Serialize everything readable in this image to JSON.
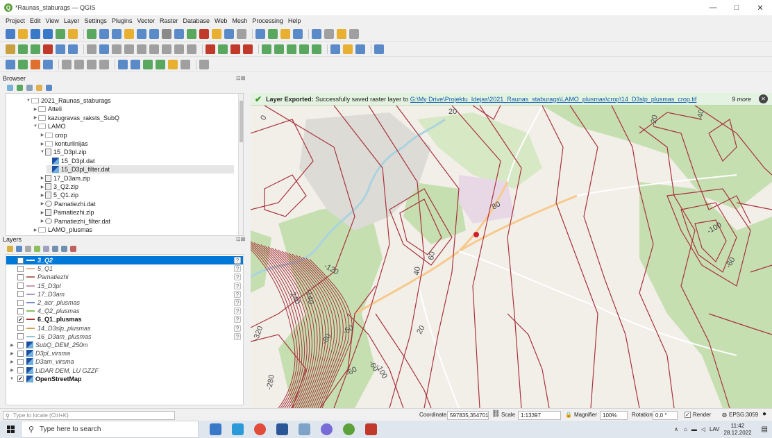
{
  "window": {
    "title": "*Raunas_staburags — QGIS",
    "controls": [
      "—",
      "□",
      "✕"
    ]
  },
  "menu": [
    "Project",
    "Edit",
    "View",
    "Layer",
    "Settings",
    "Plugins",
    "Vector",
    "Raster",
    "Database",
    "Web",
    "Mesh",
    "Processing",
    "Help"
  ],
  "browser": {
    "title": "Browser",
    "items": [
      {
        "label": "2021_Raunas_staburags",
        "icon": "folder-icon",
        "indent": 0,
        "arrow": "▼"
      },
      {
        "label": "Atteli",
        "icon": "folder-icon",
        "indent": 1,
        "arrow": "▶"
      },
      {
        "label": "kazugravas_raksts_SubQ",
        "icon": "folder-icon",
        "indent": 1,
        "arrow": "▶"
      },
      {
        "label": "LAMO",
        "icon": "folder-icon",
        "indent": 1,
        "arrow": "▼"
      },
      {
        "label": "crop",
        "icon": "folder-icon",
        "indent": 2,
        "arrow": "▶"
      },
      {
        "label": "konturlinijas",
        "icon": "folder-icon",
        "indent": 2,
        "arrow": "▶"
      },
      {
        "label": "15_D3pl.zip",
        "icon": "zip-icon",
        "indent": 2,
        "arrow": "▼"
      },
      {
        "label": "15_D3pl.dat",
        "icon": "raster-icon",
        "indent": 3,
        "arrow": ""
      },
      {
        "label": "15_D3pl_filter.dat",
        "icon": "raster-icon",
        "indent": 3,
        "arrow": "",
        "selected": true
      },
      {
        "label": "17_D3am.zip",
        "icon": "zip-icon",
        "indent": 2,
        "arrow": "▶"
      },
      {
        "label": "3_Q2.zip",
        "icon": "zip-icon",
        "indent": 2,
        "arrow": "▶"
      },
      {
        "label": "5_Q1.zip",
        "icon": "zip-icon",
        "indent": 2,
        "arrow": "▶"
      },
      {
        "label": "Pamatiezhi.dat",
        "icon": "vector-icon",
        "indent": 2,
        "arrow": "▶"
      },
      {
        "label": "Pamatiezhi.zip",
        "icon": "zip-icon",
        "indent": 2,
        "arrow": "▶"
      },
      {
        "label": "Pamatiezhi_filter.dat",
        "icon": "vector-icon",
        "indent": 2,
        "arrow": "▶"
      },
      {
        "label": "LAMO_plusmas",
        "icon": "folder-icon",
        "indent": 1,
        "arrow": "▶"
      }
    ]
  },
  "layers": {
    "title": "Layers",
    "items": [
      {
        "label": "3_Q2",
        "checked": false,
        "color": "#ffffff",
        "active": true,
        "style": "italic",
        "warn": true
      },
      {
        "label": "5_Q1",
        "checked": false,
        "color": "#d8b79a",
        "style": "italic",
        "warn": true
      },
      {
        "label": "Pamatiezhi",
        "checked": false,
        "color": "#b07060",
        "style": "italic",
        "warn": true
      },
      {
        "label": "15_D3pl",
        "checked": false,
        "color": "#c89aa8",
        "style": "italic",
        "warn": true
      },
      {
        "label": "17_D3am",
        "checked": false,
        "color": "#a89ac8",
        "style": "italic",
        "warn": true
      },
      {
        "label": "2_acr_plusmas",
        "checked": false,
        "color": "#7a8acc",
        "style": "italic",
        "warn": true
      },
      {
        "label": "4_Q2_plusmas",
        "checked": false,
        "color": "#8abf5a",
        "style": "italic",
        "warn": true
      },
      {
        "label": "6_Q1_plusmas",
        "checked": true,
        "color": "#a83232",
        "style": "bold",
        "warn": true
      },
      {
        "label": "14_D3slp_plusmas",
        "checked": false,
        "color": "#d4a24a",
        "style": "italic",
        "warn": true
      },
      {
        "label": "16_D3am_plusmas",
        "checked": false,
        "color": "#9ac0d8",
        "style": "italic",
        "warn": true
      },
      {
        "label": "SubQ_DEM_250m",
        "checked": false,
        "raster": true,
        "style": "italic"
      },
      {
        "label": "D3pl_virsma",
        "checked": false,
        "raster": true,
        "style": "italic"
      },
      {
        "label": "D3am_virsma",
        "checked": false,
        "raster": true,
        "style": "italic"
      },
      {
        "label": "LiDAR DEM, LU GZZF",
        "checked": false,
        "raster": true,
        "style": "italic"
      },
      {
        "label": "OpenStreetMap",
        "checked": true,
        "raster": true,
        "style": "bold"
      }
    ]
  },
  "message": {
    "title": "Layer Exported:",
    "text": "Successfully saved raster layer to",
    "path": "G:\\My Drive\\Projektu_Idejas\\2021_Raunas_staburags\\LAMO_plusmas\\crop\\14_D3slp_plusmas_crop.tif",
    "more": "9 more"
  },
  "map": {
    "contour_color": "#a8323c",
    "labels": [
      {
        "text": "80"
      },
      {
        "text": "20"
      },
      {
        "text": "0"
      },
      {
        "text": "-20"
      },
      {
        "text": "-40"
      },
      {
        "text": "-100"
      },
      {
        "text": "-60"
      },
      {
        "text": "60"
      },
      {
        "text": "40"
      },
      {
        "text": "-120"
      },
      {
        "text": "-240"
      },
      {
        "text": "-140"
      },
      {
        "text": "20"
      },
      {
        "text": "-60"
      },
      {
        "text": "-80"
      },
      {
        "text": "-100"
      },
      {
        "text": "-320"
      },
      {
        "text": "-280"
      },
      {
        "text": "-60"
      },
      {
        "text": "-60"
      }
    ]
  },
  "status": {
    "locator_placeholder": "Type to locate (Ctrl+K)",
    "coordinate_label": "Coordinate",
    "coordinate": "597835,354701",
    "scale_label": "Scale",
    "scale": "1:13397",
    "magnifier_label": "Magnifier",
    "magnifier": "100%",
    "rotation_label": "Rotation",
    "rotation": "0,0 °",
    "render_label": "Render",
    "crs": "EPSG:3059"
  },
  "taskbar": {
    "search_placeholder": "Type here to search",
    "lang": "LAV",
    "time": "11:42",
    "date": "28.12.2022"
  }
}
